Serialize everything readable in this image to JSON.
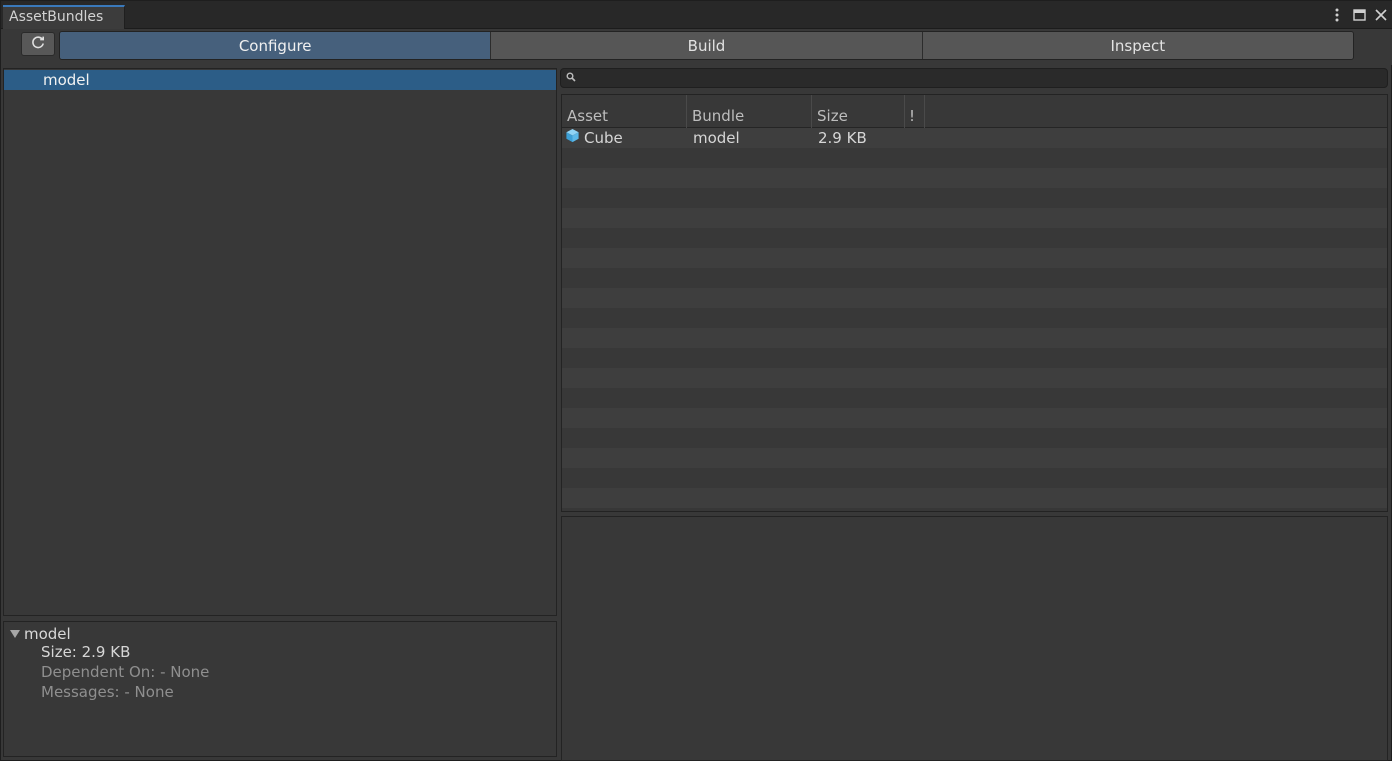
{
  "window": {
    "tab_title": "AssetBundles"
  },
  "toolbar": {
    "tabs": [
      {
        "label": "Configure",
        "active": true
      },
      {
        "label": "Build",
        "active": false
      },
      {
        "label": "Inspect",
        "active": false
      }
    ]
  },
  "bundle_list": {
    "items": [
      {
        "label": "model",
        "selected": true
      }
    ]
  },
  "details": {
    "title": "model",
    "size": "Size: 2.9 KB",
    "dependent_on": "Dependent On: - None",
    "messages": "Messages: - None"
  },
  "search": {
    "value": "",
    "placeholder": ""
  },
  "asset_table": {
    "columns": [
      "Asset",
      "Bundle",
      "Size",
      "!"
    ],
    "rows": [
      {
        "asset": "Cube",
        "bundle": "model",
        "size": "2.9 KB",
        "icon": "cube-icon"
      }
    ]
  },
  "colors": {
    "accent": "#2c5d87",
    "active_tab": "#46607c",
    "cube_icon": "#5cb8e8"
  }
}
